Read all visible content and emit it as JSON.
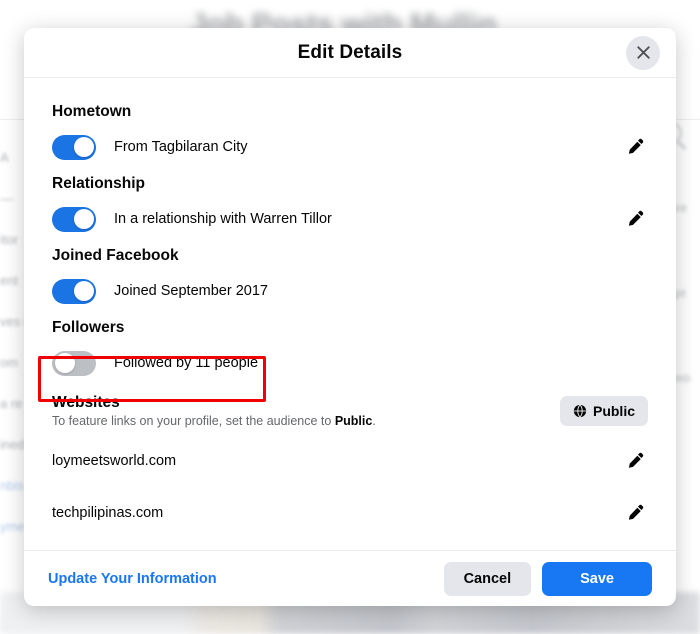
{
  "background": {
    "page_title": "Job Posts with Mullin",
    "left_fragments": [
      "A",
      "—",
      "itor",
      "ent",
      "ves i",
      "om",
      "a re",
      "ined",
      "nbis",
      "yme"
    ],
    "right_fragments": [
      "Q",
      "Eve",
      "age",
      "Pwo"
    ]
  },
  "modal": {
    "title": "Edit Details",
    "close_icon": "close-icon",
    "sections": [
      {
        "label": "Hometown",
        "toggle_state": "on",
        "text": "From Tagbilaran City",
        "edit_icon": "pencil-icon",
        "highlighted": false
      },
      {
        "label": "Relationship",
        "toggle_state": "on",
        "text": "In a relationship with Warren Tillor",
        "edit_icon": "pencil-icon",
        "highlighted": false
      },
      {
        "label": "Joined Facebook",
        "toggle_state": "on",
        "text": "Joined September 2017",
        "edit_icon": "",
        "highlighted": false
      },
      {
        "label": "Followers",
        "toggle_state": "off",
        "text": "Followed by 11 people",
        "edit_icon": "",
        "highlighted": true
      }
    ],
    "websites": {
      "label": "Websites",
      "subtitle_prefix": "To feature links on your profile, set the audience to ",
      "subtitle_bold": "Public",
      "subtitle_suffix": ".",
      "audience": {
        "label": "Public",
        "icon": "globe-icon"
      },
      "items": [
        {
          "url": "loymeetsworld.com",
          "edit_icon": "pencil-icon"
        },
        {
          "url": "techpilipinas.com",
          "edit_icon": "pencil-icon"
        }
      ]
    },
    "footer": {
      "update_link": "Update Your Information",
      "cancel_label": "Cancel",
      "save_label": "Save"
    }
  },
  "colors": {
    "accent_blue": "#1877f2",
    "toggle_on": "#1b74e4",
    "toggle_off": "#bcc0c4",
    "neutral_button": "#e4e6eb",
    "highlight_red": "#f00000"
  }
}
